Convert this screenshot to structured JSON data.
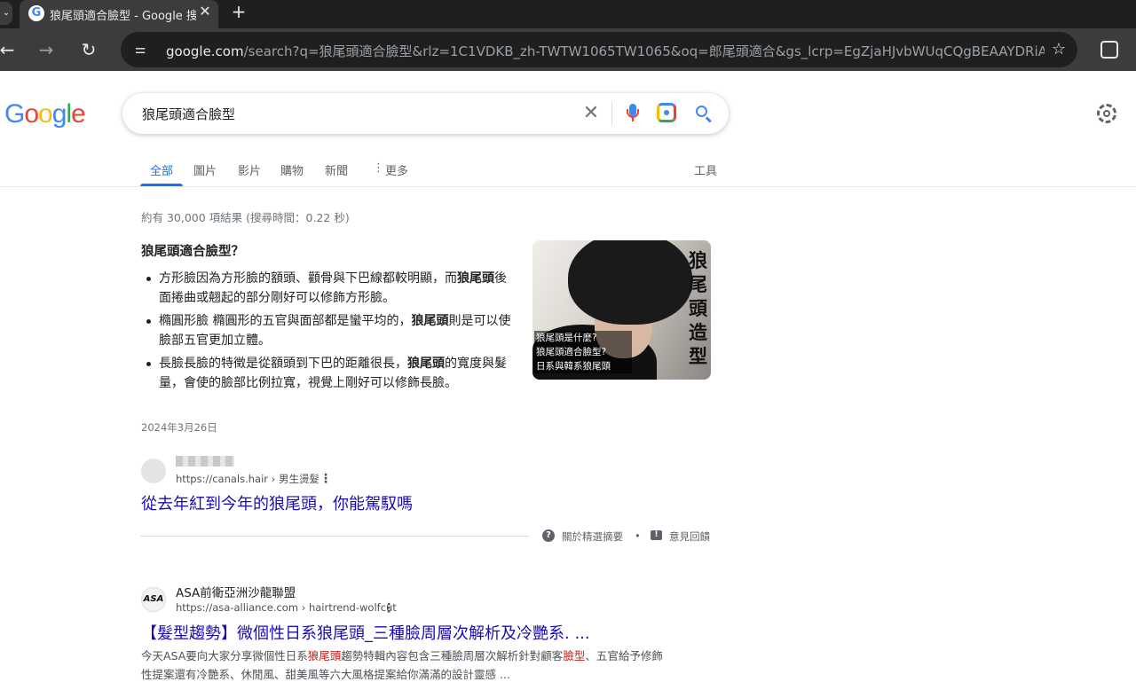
{
  "browser": {
    "tab_title": "狼尾頭適合臉型 - Google 搜",
    "tab_close": "✕",
    "new_tab": "+",
    "url_host": "google.com",
    "url_rest": "/search?q=狼尾頭適合臉型&rlz=1C1VDKB_zh-TWTW1065TW1065&oq=郎尾頭適合&gs_lcrp=EgZjaHJvbWUqCQgBEAAYDRiABD..."
  },
  "google": {
    "logo_letters": [
      "G",
      "o",
      "o",
      "g",
      "l",
      "e"
    ],
    "search_query": "狼尾頭適合臉型",
    "clear_symbol": "✕",
    "tabs": [
      "全部",
      "圖片",
      "影片",
      "購物",
      "新聞",
      "更多"
    ],
    "more_glyph": "⋮",
    "tools": "工具"
  },
  "results": {
    "stats": "約有 30,000 項結果 (搜尋時間：0.22 秒)",
    "featured": {
      "question": "狼尾頭適合臉型？",
      "items": [
        {
          "pre": "方形臉因為方形臉的額頭、顴骨與下巴線都較明顯，而",
          "bold": "狼尾頭",
          "post": "後面捲曲或翹起的部分剛好可以修飾方形臉。"
        },
        {
          "pre": "橢圓形臉 橢圓形的五官與面部都是蠻平均的，",
          "bold": "狼尾頭",
          "post": "則是可以使臉部五官更加立體。"
        },
        {
          "pre": "長臉長臉的特徵是從額頭到下巴的距離很長，",
          "bold": "狼尾頭",
          "post": "的寬度與髮量，會使的臉部比例拉寬，視覺上剛好可以修飾長臉。"
        }
      ],
      "date": "2024年3月26日",
      "thumb_vertical_text": "狼尾頭造型",
      "thumb_caption": [
        "狼尾頭是什麼?",
        "狼尾頭適合臉型?",
        "日系與韓系狼尾頭"
      ],
      "source_url": "https://canals.hair › 男生燙髮",
      "source_title": "從去年紅到今年的狼尾頭，你能駕馭嗎",
      "about_label": "關於精選摘要",
      "separator": "•",
      "feedback_label": "意見回饋"
    },
    "second": {
      "favicon_text": "ASA",
      "site_name": "ASA前衛亞洲沙龍聯盟",
      "url": "https://asa-alliance.com › hairtrend-wolfcut",
      "title": "【髮型趨勢】微個性日系狼尾頭_三種臉周層次解析及冷艷系. ...",
      "snippet_1": "今天ASA要向大家分享微個性日系",
      "snippet_hl_1": "狼尾頭",
      "snippet_2": "趨勢特輯內容包含三種臉周層次解析針對顧客",
      "snippet_hl_2": "臉型",
      "snippet_3": "、五官給予修飾性提案還有冷艷系、休閒風、甜美風等六大風格提案給你滿滿的設計靈感 ..."
    }
  },
  "colors": {
    "link": "#1a0dab",
    "accent": "#1a73e8",
    "highlight": "#c5221f"
  }
}
